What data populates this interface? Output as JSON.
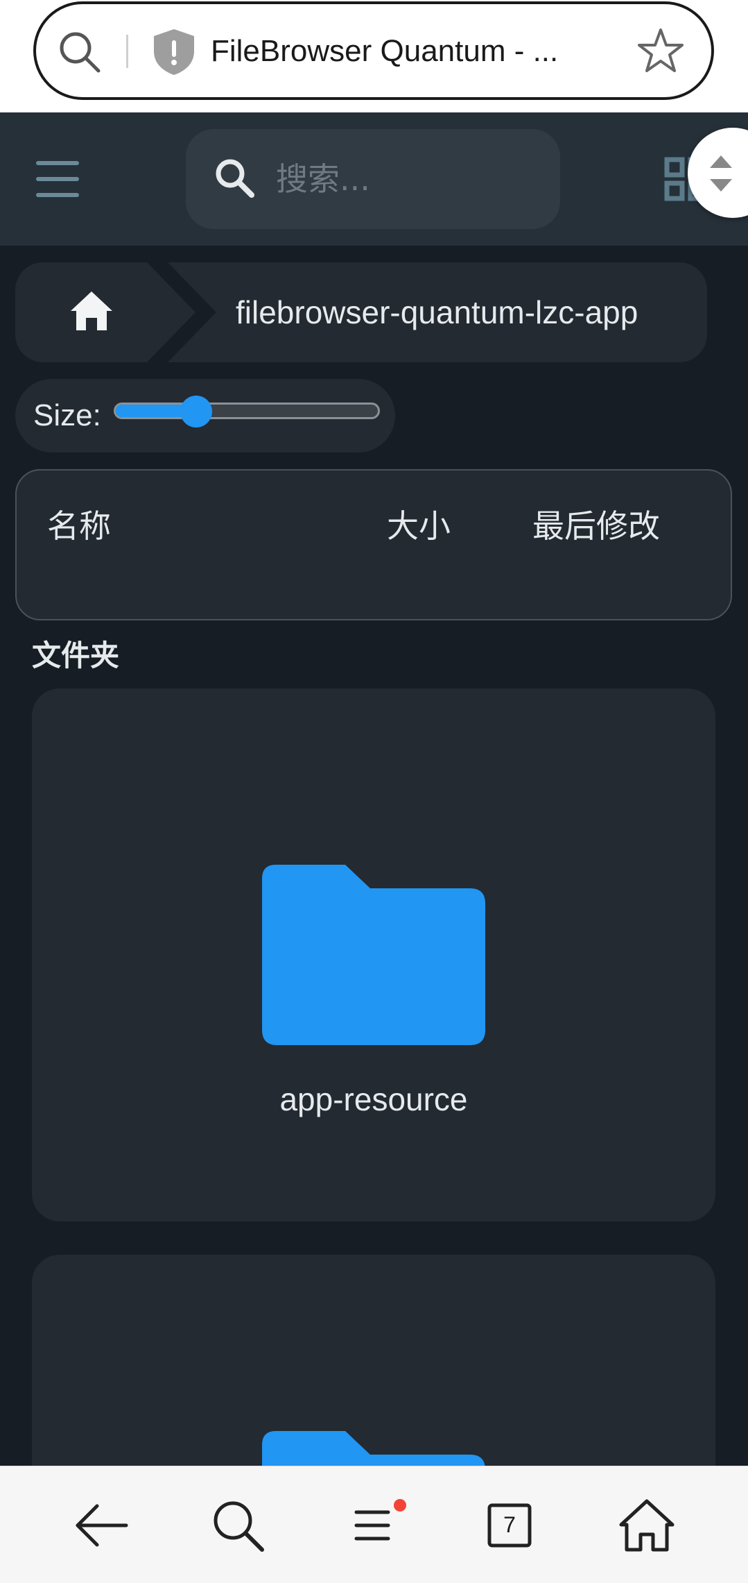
{
  "browser": {
    "tab_title": "FileBrowser Quantum - ...",
    "tabs_count": "7"
  },
  "header": {
    "search_placeholder": "搜索..."
  },
  "breadcrumb": {
    "path": "filebrowser-quantum-lzc-app"
  },
  "size_control": {
    "label": "Size:",
    "value_fraction": 0.31
  },
  "list_header": {
    "name": "名称",
    "size": "大小",
    "modified": "最后修改"
  },
  "sections": {
    "folders_title": "文件夹"
  },
  "folders": [
    {
      "name": "app-resource"
    },
    {
      "name": ""
    }
  ],
  "colors": {
    "accent": "#2196f3",
    "background": "#161d24",
    "header": "#263038",
    "card": "#232a31",
    "notification_dot": "#f44336"
  },
  "icons": {
    "url_search": "search-icon",
    "url_site_info": "shield-warning-icon",
    "url_bookmark": "star-icon",
    "app_menu": "hamburger-menu-icon",
    "app_search": "search-icon",
    "view_toggle": "grid-view-icon",
    "scroll": "scroll-handle-icon",
    "home": "home-icon",
    "folder": "folder-icon",
    "nav_back": "arrow-left-icon",
    "nav_search": "search-icon",
    "nav_menu": "menu-icon",
    "nav_tabs": "tabs-icon",
    "nav_home": "home-icon"
  }
}
